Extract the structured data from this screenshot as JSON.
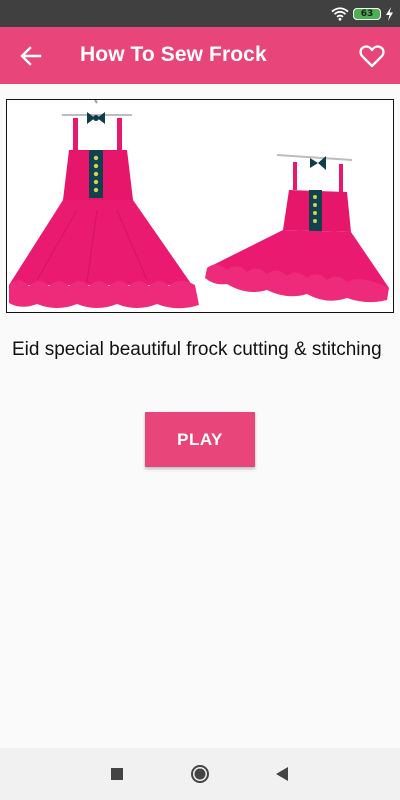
{
  "status_bar": {
    "battery_level": "63",
    "icons": [
      "wifi-icon",
      "battery-icon",
      "charging-icon"
    ]
  },
  "app_bar": {
    "title": "How To Sew Frock",
    "back_icon": "arrow-back-icon",
    "favorite_icon": "heart-outline-icon",
    "color": "#e8467a"
  },
  "video": {
    "thumbnail_description": "two pink frocks with ruffled hem",
    "title": "Eid special beautiful frock cutting & stitching"
  },
  "actions": {
    "play_label": "PLAY"
  },
  "nav_bar": {
    "icons": [
      "recents-square-icon",
      "home-circle-icon",
      "back-triangle-icon"
    ]
  }
}
